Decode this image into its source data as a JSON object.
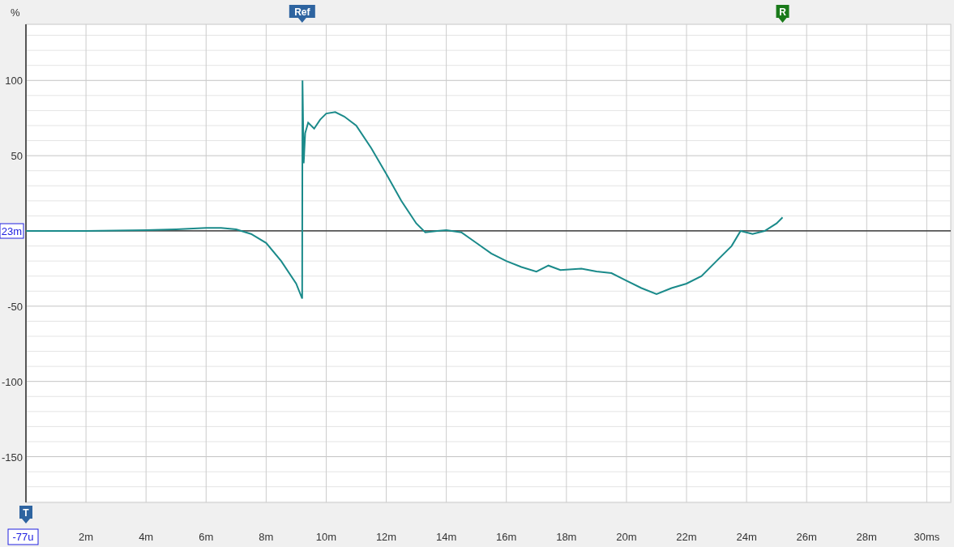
{
  "chart": {
    "cursor": {
      "x_reading": "-77u",
      "y_reading": "23m"
    },
    "markers": [
      {
        "label": "Ref",
        "color": "#2e64a0"
      },
      {
        "label": "R",
        "color": "#1a7a1a"
      },
      {
        "label": "T",
        "color": "#2e64a0"
      }
    ],
    "chart_data": {
      "type": "line",
      "ylabel": "%",
      "xlim": [
        0,
        30.8
      ],
      "ylim": [
        -180.4,
        137.3
      ],
      "grid": true,
      "xticks": [
        {
          "value": 2,
          "label": "2m"
        },
        {
          "value": 4,
          "label": "4m"
        },
        {
          "value": 6,
          "label": "6m"
        },
        {
          "value": 8,
          "label": "8m"
        },
        {
          "value": 10,
          "label": "10m"
        },
        {
          "value": 12,
          "label": "12m"
        },
        {
          "value": 14,
          "label": "14m"
        },
        {
          "value": 16,
          "label": "16m"
        },
        {
          "value": 18,
          "label": "18m"
        },
        {
          "value": 20,
          "label": "20m"
        },
        {
          "value": 22,
          "label": "22m"
        },
        {
          "value": 24,
          "label": "24m"
        },
        {
          "value": 26,
          "label": "26m"
        },
        {
          "value": 28,
          "label": "28m"
        },
        {
          "value": 30,
          "label": "30ms"
        }
      ],
      "yticks": [
        100,
        50,
        -50,
        -100,
        -150
      ],
      "x": [
        0,
        2,
        4,
        5,
        6,
        6.5,
        7,
        7.5,
        8,
        8.5,
        9,
        9.2,
        9.21,
        9.25,
        9.3,
        9.4,
        9.6,
        9.8,
        10,
        10.3,
        10.6,
        11,
        11.5,
        12,
        12.5,
        13,
        13.3,
        13.7,
        14,
        14.5,
        15,
        15.5,
        16,
        16.5,
        17,
        17.4,
        17.8,
        18.5,
        19,
        19.5,
        20,
        20.5,
        21,
        21.5,
        22,
        22.5,
        23,
        23.5,
        23.8,
        24.2,
        24.6,
        25,
        25.2
      ],
      "series": [
        {
          "color": "#1a8a8a",
          "values": [
            0,
            0,
            0.5,
            1,
            2,
            2,
            1,
            -2,
            -8,
            -20,
            -35,
            -45,
            100,
            45,
            65,
            72,
            68,
            74,
            78,
            79,
            76,
            70,
            55,
            38,
            20,
            5,
            -1,
            0,
            0.5,
            -1,
            -8,
            -15,
            -20,
            -24,
            -27,
            -23,
            -26,
            -25,
            -27,
            -28,
            -33,
            -38,
            -42,
            -38,
            -35,
            -30,
            -20,
            -10,
            0,
            -2,
            0,
            5,
            9
          ]
        }
      ]
    }
  }
}
